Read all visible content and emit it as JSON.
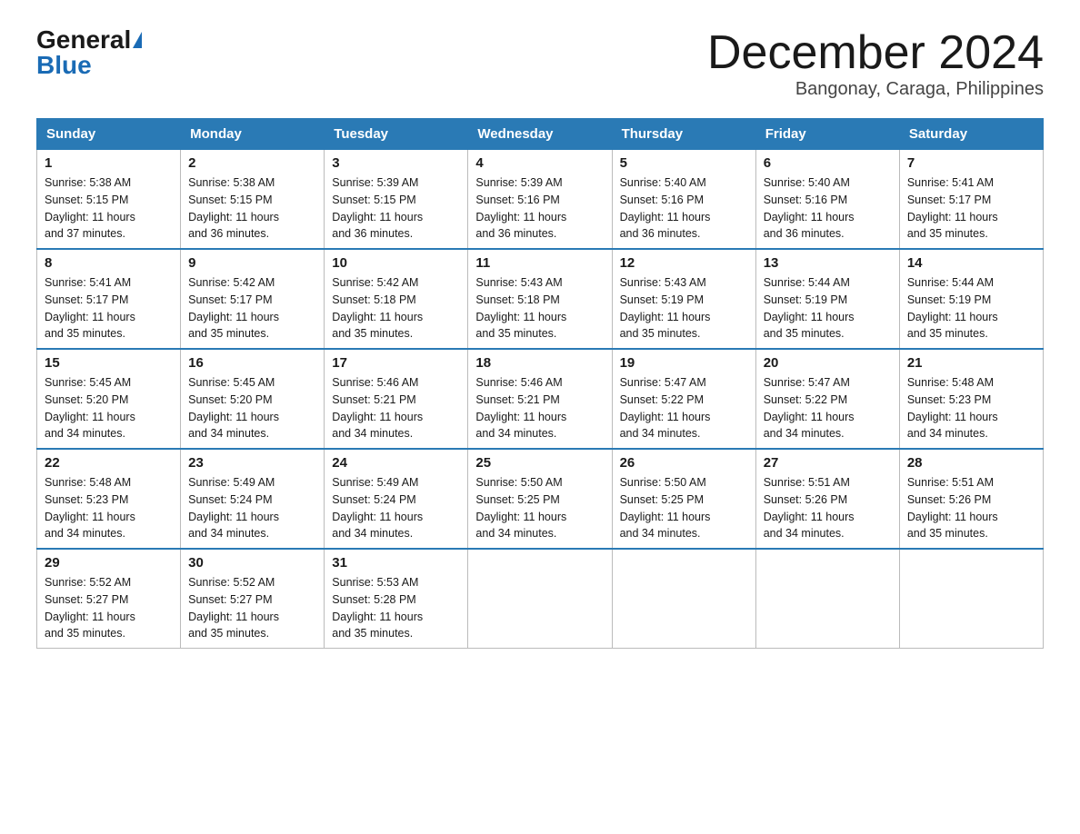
{
  "logo": {
    "general": "General",
    "blue": "Blue"
  },
  "title": "December 2024",
  "location": "Bangonay, Caraga, Philippines",
  "weekdays": [
    "Sunday",
    "Monday",
    "Tuesday",
    "Wednesday",
    "Thursday",
    "Friday",
    "Saturday"
  ],
  "weeks": [
    [
      {
        "day": "1",
        "sunrise": "5:38 AM",
        "sunset": "5:15 PM",
        "daylight": "11 hours and 37 minutes."
      },
      {
        "day": "2",
        "sunrise": "5:38 AM",
        "sunset": "5:15 PM",
        "daylight": "11 hours and 36 minutes."
      },
      {
        "day": "3",
        "sunrise": "5:39 AM",
        "sunset": "5:15 PM",
        "daylight": "11 hours and 36 minutes."
      },
      {
        "day": "4",
        "sunrise": "5:39 AM",
        "sunset": "5:16 PM",
        "daylight": "11 hours and 36 minutes."
      },
      {
        "day": "5",
        "sunrise": "5:40 AM",
        "sunset": "5:16 PM",
        "daylight": "11 hours and 36 minutes."
      },
      {
        "day": "6",
        "sunrise": "5:40 AM",
        "sunset": "5:16 PM",
        "daylight": "11 hours and 36 minutes."
      },
      {
        "day": "7",
        "sunrise": "5:41 AM",
        "sunset": "5:17 PM",
        "daylight": "11 hours and 35 minutes."
      }
    ],
    [
      {
        "day": "8",
        "sunrise": "5:41 AM",
        "sunset": "5:17 PM",
        "daylight": "11 hours and 35 minutes."
      },
      {
        "day": "9",
        "sunrise": "5:42 AM",
        "sunset": "5:17 PM",
        "daylight": "11 hours and 35 minutes."
      },
      {
        "day": "10",
        "sunrise": "5:42 AM",
        "sunset": "5:18 PM",
        "daylight": "11 hours and 35 minutes."
      },
      {
        "day": "11",
        "sunrise": "5:43 AM",
        "sunset": "5:18 PM",
        "daylight": "11 hours and 35 minutes."
      },
      {
        "day": "12",
        "sunrise": "5:43 AM",
        "sunset": "5:19 PM",
        "daylight": "11 hours and 35 minutes."
      },
      {
        "day": "13",
        "sunrise": "5:44 AM",
        "sunset": "5:19 PM",
        "daylight": "11 hours and 35 minutes."
      },
      {
        "day": "14",
        "sunrise": "5:44 AM",
        "sunset": "5:19 PM",
        "daylight": "11 hours and 35 minutes."
      }
    ],
    [
      {
        "day": "15",
        "sunrise": "5:45 AM",
        "sunset": "5:20 PM",
        "daylight": "11 hours and 34 minutes."
      },
      {
        "day": "16",
        "sunrise": "5:45 AM",
        "sunset": "5:20 PM",
        "daylight": "11 hours and 34 minutes."
      },
      {
        "day": "17",
        "sunrise": "5:46 AM",
        "sunset": "5:21 PM",
        "daylight": "11 hours and 34 minutes."
      },
      {
        "day": "18",
        "sunrise": "5:46 AM",
        "sunset": "5:21 PM",
        "daylight": "11 hours and 34 minutes."
      },
      {
        "day": "19",
        "sunrise": "5:47 AM",
        "sunset": "5:22 PM",
        "daylight": "11 hours and 34 minutes."
      },
      {
        "day": "20",
        "sunrise": "5:47 AM",
        "sunset": "5:22 PM",
        "daylight": "11 hours and 34 minutes."
      },
      {
        "day": "21",
        "sunrise": "5:48 AM",
        "sunset": "5:23 PM",
        "daylight": "11 hours and 34 minutes."
      }
    ],
    [
      {
        "day": "22",
        "sunrise": "5:48 AM",
        "sunset": "5:23 PM",
        "daylight": "11 hours and 34 minutes."
      },
      {
        "day": "23",
        "sunrise": "5:49 AM",
        "sunset": "5:24 PM",
        "daylight": "11 hours and 34 minutes."
      },
      {
        "day": "24",
        "sunrise": "5:49 AM",
        "sunset": "5:24 PM",
        "daylight": "11 hours and 34 minutes."
      },
      {
        "day": "25",
        "sunrise": "5:50 AM",
        "sunset": "5:25 PM",
        "daylight": "11 hours and 34 minutes."
      },
      {
        "day": "26",
        "sunrise": "5:50 AM",
        "sunset": "5:25 PM",
        "daylight": "11 hours and 34 minutes."
      },
      {
        "day": "27",
        "sunrise": "5:51 AM",
        "sunset": "5:26 PM",
        "daylight": "11 hours and 34 minutes."
      },
      {
        "day": "28",
        "sunrise": "5:51 AM",
        "sunset": "5:26 PM",
        "daylight": "11 hours and 35 minutes."
      }
    ],
    [
      {
        "day": "29",
        "sunrise": "5:52 AM",
        "sunset": "5:27 PM",
        "daylight": "11 hours and 35 minutes."
      },
      {
        "day": "30",
        "sunrise": "5:52 AM",
        "sunset": "5:27 PM",
        "daylight": "11 hours and 35 minutes."
      },
      {
        "day": "31",
        "sunrise": "5:53 AM",
        "sunset": "5:28 PM",
        "daylight": "11 hours and 35 minutes."
      },
      null,
      null,
      null,
      null
    ]
  ],
  "labels": {
    "sunrise": "Sunrise:",
    "sunset": "Sunset:",
    "daylight": "Daylight:"
  }
}
